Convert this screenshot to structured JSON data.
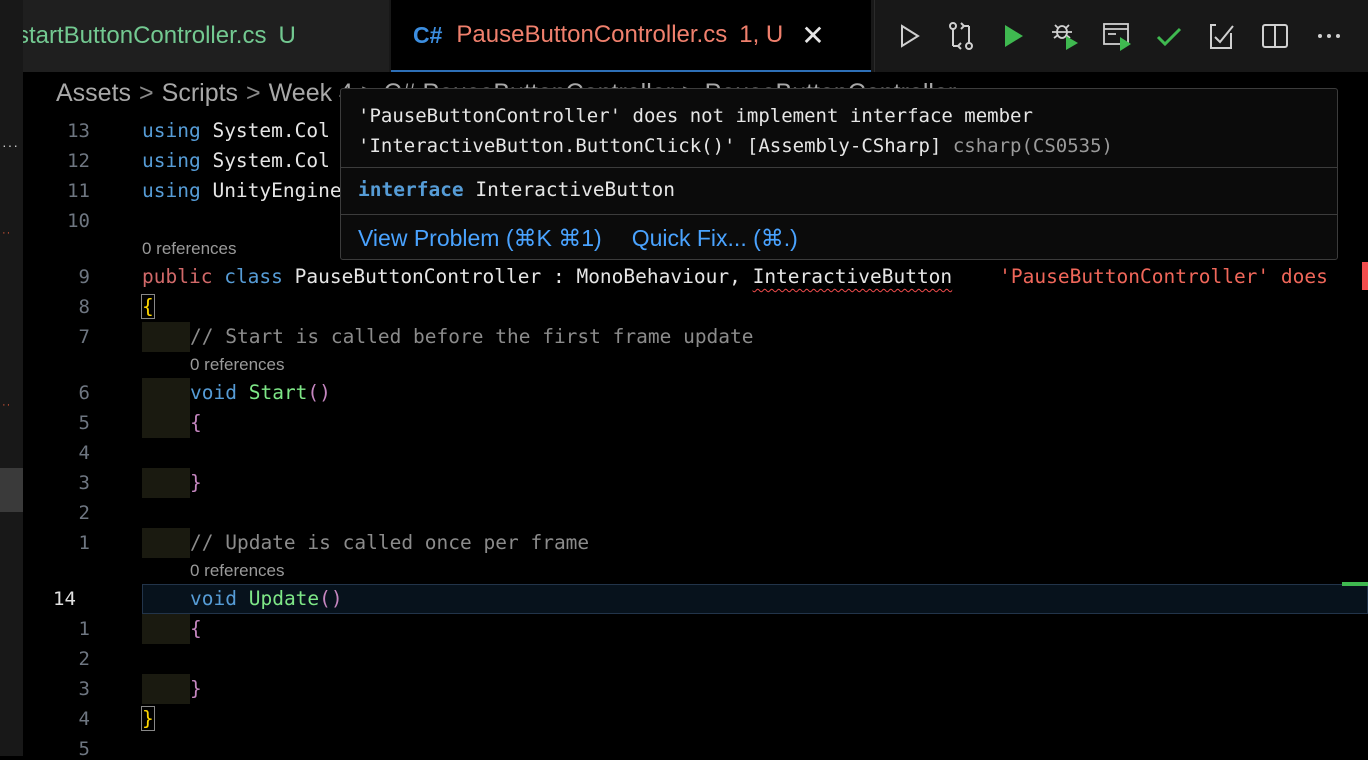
{
  "tabs": [
    {
      "name": "startButtonController.cs",
      "status": "U"
    },
    {
      "icon": "C#",
      "name": "PauseButtonController.cs",
      "status": "1, U",
      "close": "✕"
    }
  ],
  "toolbar": [
    "run-icon",
    "compare-icon",
    "debug-run-icon",
    "debug-bug-icon",
    "run-window-icon",
    "check-icon",
    "source-control-icon",
    "split-editor-icon",
    "more-icon"
  ],
  "breadcrumb": {
    "items": [
      "Assets",
      "Scripts",
      "Week 4",
      "C# PauseButtonController",
      "PauseButtonController"
    ],
    "sep": ">"
  },
  "hover": {
    "line1": "'PauseButtonController' does not implement interface member",
    "line2": "'InteractiveButton.ButtonClick()' [Assembly-CSharp]",
    "code": "csharp(CS0535)",
    "sig_kw": "interface",
    "sig_name": "InteractiveButton",
    "view_problem": "View Problem (⌘K ⌘1)",
    "quick_fix": "Quick Fix... (⌘.)"
  },
  "code": {
    "using": "using",
    "ns1": "System.Col",
    "ns2": "System.Col",
    "ns3": "UnityEngine",
    "refs": "0 references",
    "public": "public",
    "class": "class",
    "class_name": "PauseButtonController",
    "colon": ":",
    "base": "MonoBehaviour,",
    "iface": "InteractiveButton",
    "inline_error": "'PauseButtonController' does",
    "brace_open": "{",
    "brace_close": "}",
    "comment_start": "// Start is called before the first frame update",
    "comment_update": "// Update is called once per frame",
    "void": "void",
    "start": "Start",
    "update": "Update",
    "parens": "()"
  },
  "line_numbers": [
    "13",
    "12",
    "11",
    "10",
    "9",
    "8",
    "7",
    "6",
    "5",
    "4",
    "3",
    "2",
    "1",
    "14",
    "1",
    "2",
    "3",
    "4",
    "5"
  ],
  "colors": {
    "error": "#f14c4c",
    "accent": "#2d6fb7",
    "modified": "#73c991"
  }
}
